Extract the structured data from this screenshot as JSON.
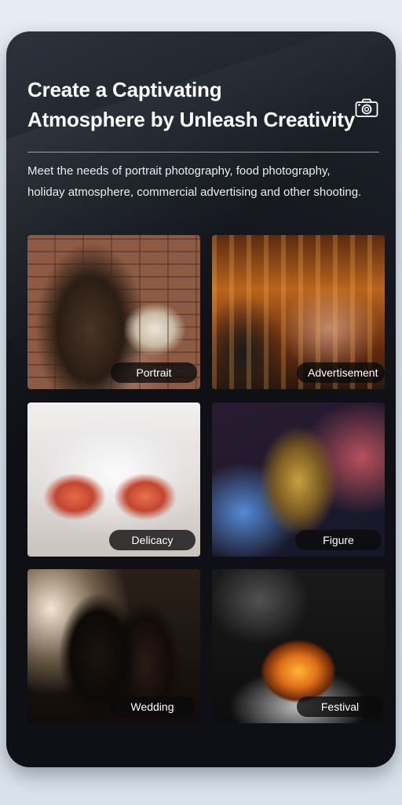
{
  "header": {
    "title_line1": "Create a Captivating",
    "title_line2": "Atmosphere by Unleash Creativity",
    "icon": "camera-icon"
  },
  "description": {
    "line1": "Meet the needs of portrait photography, food photography,",
    "line2": "holiday atmosphere, commercial advertising and other shooting."
  },
  "gallery": [
    {
      "label": "Portrait"
    },
    {
      "label": "Advertisement"
    },
    {
      "label": "Delicacy"
    },
    {
      "label": "Figure"
    },
    {
      "label": "Wedding"
    },
    {
      "label": "Festival"
    }
  ]
}
